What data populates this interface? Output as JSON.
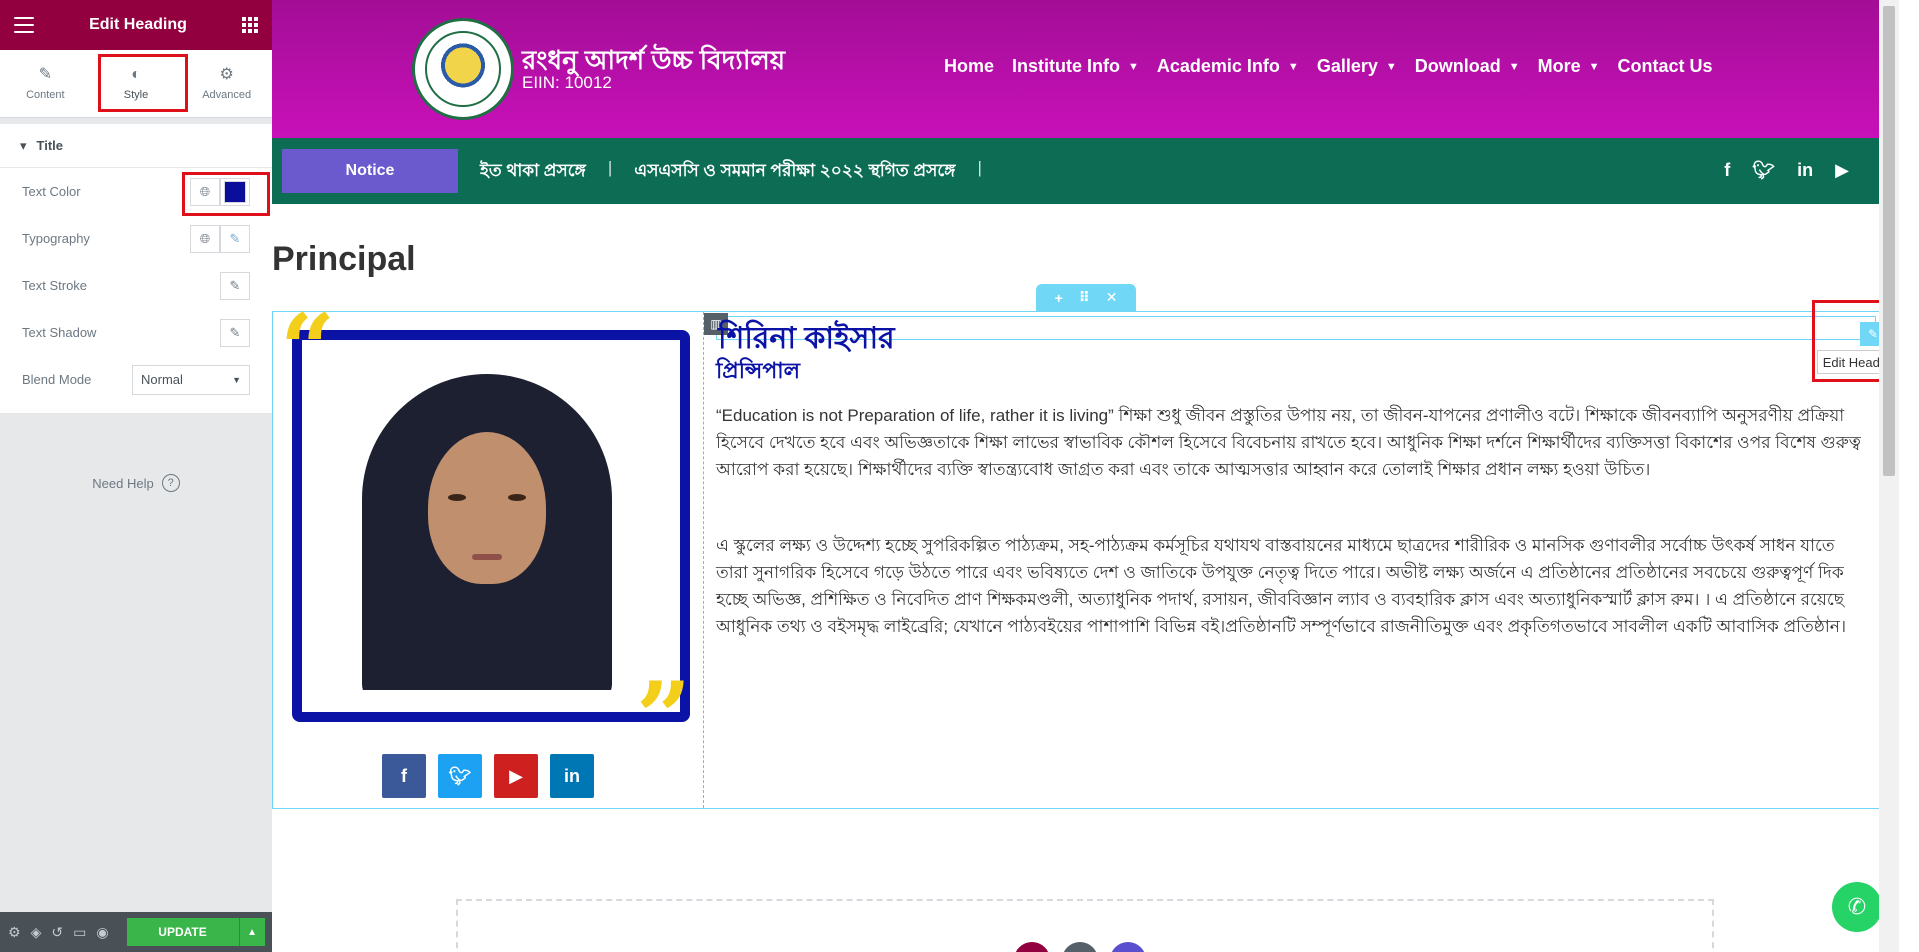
{
  "panel": {
    "title": "Edit Heading",
    "tabs": [
      {
        "label": "Content",
        "icon": "pencil-icon"
      },
      {
        "label": "Style",
        "icon": "contrast-icon"
      },
      {
        "label": "Advanced",
        "icon": "gear-icon"
      }
    ],
    "section_title": "Title",
    "controls": {
      "text_color": "Text Color",
      "typography": "Typography",
      "text_stroke": "Text Stroke",
      "text_shadow": "Text Shadow",
      "blend_mode": "Blend Mode",
      "blend_mode_value": "Normal"
    },
    "need_help": "Need Help",
    "update": "UPDATE",
    "accent_color": "#93003f",
    "swatch_color": "#0b0e9a"
  },
  "site": {
    "school_name": "রংধনু আদর্শ উচ্চ বিদ্যালয়",
    "eiin": "EIIN: 10012",
    "nav": [
      "Home",
      "Institute Info",
      "Academic Info",
      "Gallery",
      "Download",
      "More",
      "Contact Us"
    ],
    "notice_label": "Notice",
    "ticker": [
      "ইত থাকা প্রসঙ্গে",
      "এসএসসি ও সমমান পরীক্ষা ২০২২ স্থগিত প্রসঙ্গে"
    ],
    "page_heading": "Principal",
    "person": {
      "name": "শিরিনা কাইসার",
      "designation": "প্রিন্সিপাল",
      "para1": "“Education is not Preparation of life, rather it is living” শিক্ষা শুধু জীবন প্রস্তুতির উপায় নয়, তা জীবন-যাপনের প্রণালীও বটে। শিক্ষাকে জীবনব্যাপি অনুসরণীয় প্রক্রিয়া হিসেবে দেখতে হবে এবং অভিজ্ঞতাকে শিক্ষা লাভের স্বাভাবিক কৌশল হিসেবে বিবেচনায় রাখতে হবে। আধুনিক শিক্ষা দর্শনে শিক্ষার্থীদের ব্যক্তিসত্তা বিকাশের ওপর বিশেষ গুরুত্ব আরোপ করা হয়েছে। শিক্ষার্থীদের ব্যক্তি স্বাতন্ত্র্যবোধ জাগ্রত করা এবং তাকে আত্মসত্তার আহ্বান করে তোলাই শিক্ষার প্রধান লক্ষ্য হওয়া উচিত।",
      "para2": "এ স্কুলের লক্ষ্য ও উদ্দেশ্য হচ্ছে সুপরিকল্পিত পাঠ্যক্রম, সহ-পাঠ্যক্রম কর্মসূচির যথাযথ বাস্তবায়নের মাধ্যমে ছাত্রদের শারীরিক ও মানসিক গুণাবলীর সর্বোচ্চ উৎকর্ষ সাধন যাতে তারা সুনাগরিক হিসেবে গড়ে উঠতে পারে এবং ভবিষ্যতে দেশ ও জাতিকে উপযুক্ত নেতৃত্ব দিতে পারে। অভীষ্ট লক্ষ্য অর্জনে এ প্রতিষ্ঠানের প্রতিষ্ঠানের সবচেয়ে গুরুত্বপূর্ণ দিক হচ্ছে অভিজ্ঞ, প্রশিক্ষিত ও নিবেদিত প্রাণ শিক্ষকমণ্ডলী, অত্যাধুনিক পদার্থ, রসায়ন, জীববিজ্ঞান ল্যাব ও ব্যবহারিক ক্লাস এবং অত্যাধুনিকস্মার্ট ক্লাস রুম। । এ প্রতিষ্ঠানে রয়েছে আধুনিক তথ্য ও বইসমৃদ্ধ লাইব্রেরি; যেখানে পাঠ্যবইয়ের পাশাপাশি বিভিন্ন বই।প্রতিষ্ঠানটি সম্পূর্ণভাবে রাজনীতিমুক্ত এবং প্রকৃতিগতভাবে সাবলীল একটি আবাসিক প্রতিষ্ঠান।"
    },
    "edit_tooltip": "Edit Heading",
    "colors": {
      "header": "#c810b9",
      "notice_bar": "#0c6d54",
      "notice_button": "#6a5acd",
      "heading_blue": "#0b13a6",
      "quote_yellow": "#f3cf1c",
      "editor_outline": "#71d7f7"
    },
    "social_icons": [
      "facebook-icon",
      "twitter-icon",
      "linkedin-icon",
      "youtube-icon"
    ]
  }
}
